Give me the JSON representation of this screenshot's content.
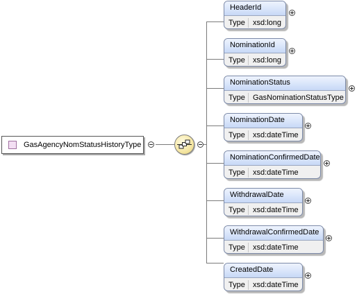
{
  "root": {
    "name": "GasAgencyNomStatusHistoryType"
  },
  "compositor": {
    "kind": "sequence",
    "icon": "sequence-icon"
  },
  "type_label": "Type",
  "elements": [
    {
      "name": "HeaderId",
      "type": "xsd:long"
    },
    {
      "name": "NominationId",
      "type": "xsd:long"
    },
    {
      "name": "NominationStatus",
      "type": "GasNominationStatusType"
    },
    {
      "name": "NominationDate",
      "type": "xsd:dateTime"
    },
    {
      "name": "NominationConfirmedDate",
      "type": "xsd:dateTime"
    },
    {
      "name": "WithdrawalDate",
      "type": "xsd:dateTime"
    },
    {
      "name": "WithdrawalConfirmedDate",
      "type": "xsd:dateTime"
    },
    {
      "name": "CreatedDate",
      "type": "xsd:dateTime"
    }
  ],
  "colors": {
    "header": "#d4e2fa",
    "body": "#f0f0f0",
    "compositor": "#f6e8a8",
    "root_square": "#f3dff3"
  }
}
